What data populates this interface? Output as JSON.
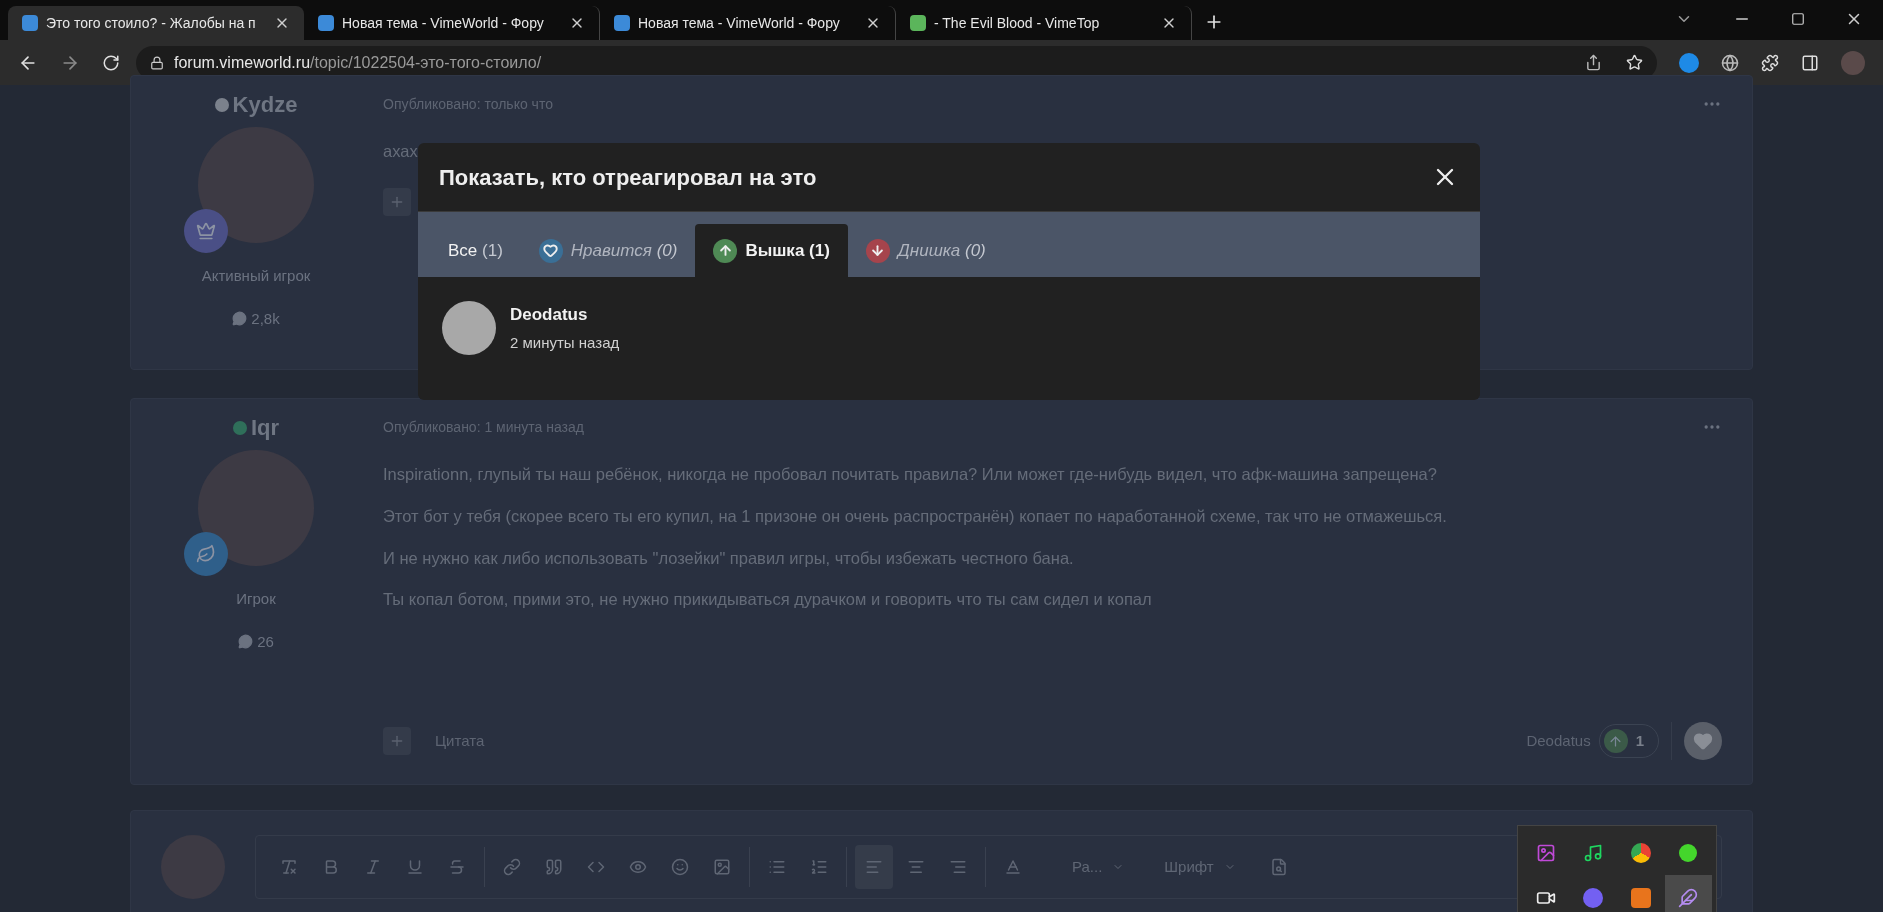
{
  "browser": {
    "tabs": [
      {
        "title": "Это того стоило? - Жалобы на п",
        "kind": "vimeworld",
        "selected": true
      },
      {
        "title": "Новая тема - VimeWorld - Фору",
        "kind": "vimeworld",
        "selected": false
      },
      {
        "title": "Новая тема - VimeWorld - Фору",
        "kind": "vimeworld",
        "selected": false
      },
      {
        "title": "- The Evil Blood - VimeTop",
        "kind": "vimetop",
        "selected": false
      }
    ],
    "address": {
      "domain": "forum.vimeworld.ru",
      "path": "/topic/1022504-это-того-стоило/"
    }
  },
  "posts": [
    {
      "author": "Kydze",
      "color": "#7b818c",
      "kind": "crown",
      "role": "Активный игрок",
      "posts_count": "2,8k",
      "published": "Опубликовано: только что",
      "body": [
        "ахах"
      ]
    },
    {
      "author": "Iqr",
      "color": "#2f6f5a",
      "kind": "leaf",
      "role": "Игрок",
      "posts_count": "26",
      "published": "Опубликовано: 1 минута назад",
      "body": [
        "Inspirationn, глупый ты наш ребёнок, никогда не пробовал почитать правила? Или может где-нибудь видел, что афк-машина запрещена?",
        "Этот бот у тебя (скорее всего ты его купил, на 1 призоне он очень распространён) копает по наработанной схеме, так что не отмажешься.",
        "И не нужно как либо использовать \"лозейки\" правил игры, чтобы избежать честного бана.",
        "Ты копал ботом, прими это, не нужно прикидываться дурачком и говорить что ты сам сидел и копал"
      ],
      "footer": {
        "quote": "Цитата",
        "reacted_by": "Deodatus",
        "reaction_count": "1"
      }
    }
  ],
  "editor": {
    "toolbar": [
      {
        "kind": "clear",
        "selected": false
      },
      {
        "kind": "bold",
        "selected": false
      },
      {
        "kind": "italic",
        "selected": false
      },
      {
        "kind": "underline",
        "selected": false
      },
      {
        "kind": "strike",
        "selected": false
      },
      {
        "kind": "link",
        "selected": false
      },
      {
        "kind": "quote",
        "selected": false
      },
      {
        "kind": "code",
        "selected": false
      },
      {
        "kind": "spoiler",
        "selected": false
      },
      {
        "kind": "emoji",
        "selected": false
      },
      {
        "kind": "gif",
        "selected": false
      },
      {
        "kind": "bullets",
        "selected": false
      },
      {
        "kind": "numbers",
        "selected": false
      },
      {
        "kind": "align-left",
        "selected": true
      },
      {
        "kind": "align-center",
        "selected": false
      },
      {
        "kind": "align-right",
        "selected": false
      },
      {
        "kind": "color",
        "selected": false
      }
    ],
    "dropdowns": [
      "Ра...",
      "Шрифт"
    ]
  },
  "modal": {
    "title": "Показать, кто отреагировал на это",
    "tabs": [
      {
        "kind": "all",
        "label": "Все",
        "count": "(1)",
        "disabled": false,
        "selected": false
      },
      {
        "kind": "like",
        "label": "Нравится",
        "count": "(0)",
        "disabled": true,
        "selected": false
      },
      {
        "kind": "up",
        "label": "Вышка",
        "count": "(1)",
        "disabled": false,
        "selected": true
      },
      {
        "kind": "down",
        "label": "Днишка",
        "count": "(0)",
        "disabled": true,
        "selected": false
      }
    ],
    "users": [
      {
        "name": "Deodatus",
        "time": "2 минуты назад"
      }
    ]
  }
}
